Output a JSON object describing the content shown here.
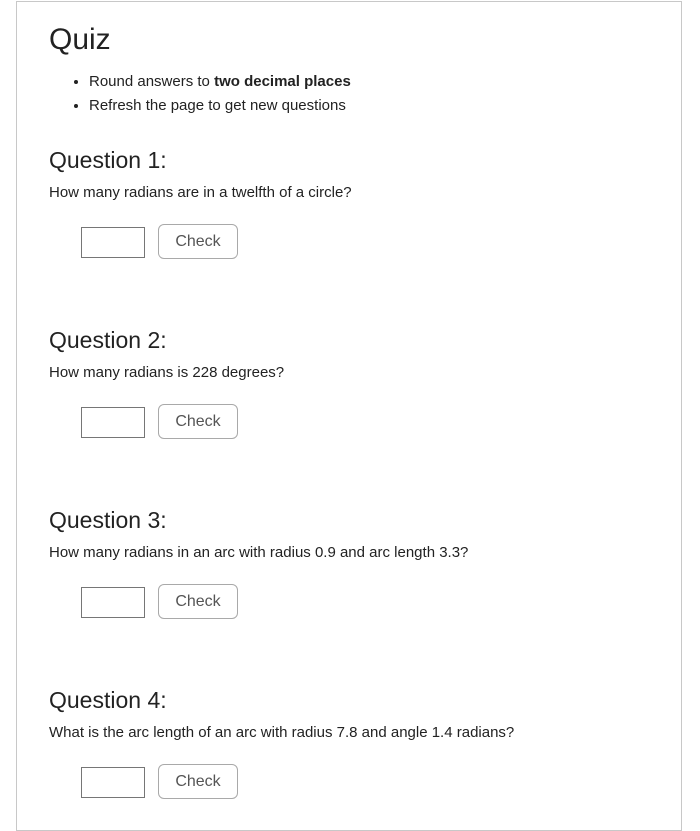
{
  "quiz": {
    "title": "Quiz",
    "instructions": {
      "line1_prefix": "Round answers to ",
      "line1_bold": "two decimal places",
      "line2": "Refresh the page to get new questions"
    },
    "questions": [
      {
        "heading": "Question 1:",
        "text": "How many radians are in a twelfth of a circle?",
        "answer_value": "",
        "button_label": "Check"
      },
      {
        "heading": "Question 2:",
        "text": "How many radians is 228 degrees?",
        "answer_value": "",
        "button_label": "Check"
      },
      {
        "heading": "Question 3:",
        "text": "How many radians in an arc with radius 0.9 and arc length 3.3?",
        "answer_value": "",
        "button_label": "Check"
      },
      {
        "heading": "Question 4:",
        "text": "What is the arc length of an arc with radius 7.8 and angle 1.4 radians?",
        "answer_value": "",
        "button_label": "Check"
      }
    ]
  }
}
